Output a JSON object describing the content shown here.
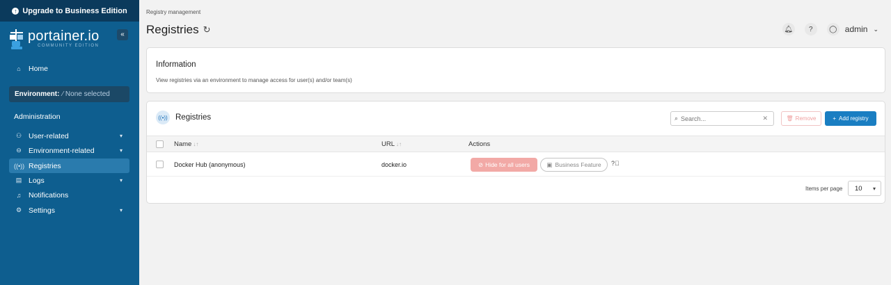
{
  "upgrade_banner": {
    "label": "Upgrade to Business Edition"
  },
  "brand": {
    "name": "portainer.io",
    "edition": "COMMUNITY EDITION"
  },
  "sidebar": {
    "collapse_label": "«",
    "home": "Home",
    "environment_label": "Environment:",
    "environment_value": "None selected",
    "section_title": "Administration",
    "items": [
      {
        "label": "User-related"
      },
      {
        "label": "Environment-related"
      },
      {
        "label": "Registries"
      },
      {
        "label": "Logs"
      },
      {
        "label": "Notifications"
      },
      {
        "label": "Settings"
      }
    ]
  },
  "header": {
    "breadcrumb": "Registry management",
    "title": "Registries",
    "user": "admin"
  },
  "info_card": {
    "title": "Information",
    "text": "View registries via an environment to manage access for user(s) and/or team(s)"
  },
  "registries_card": {
    "title": "Registries",
    "search_placeholder": "Search...",
    "remove_label": "Remove",
    "add_label": "Add registry",
    "columns": [
      "Name",
      "URL",
      "Actions"
    ],
    "rows": [
      {
        "name": "Docker Hub (anonymous)",
        "url": "docker.io",
        "hide_label": "Hide for all users",
        "business_label": "Business Feature"
      }
    ],
    "items_per_page_label": "Items per page",
    "items_per_page": "10"
  },
  "colors": {
    "sidebar": "#0e5e8f",
    "accent": "#1a7ec2",
    "danger_light": "#f2a9a6"
  }
}
